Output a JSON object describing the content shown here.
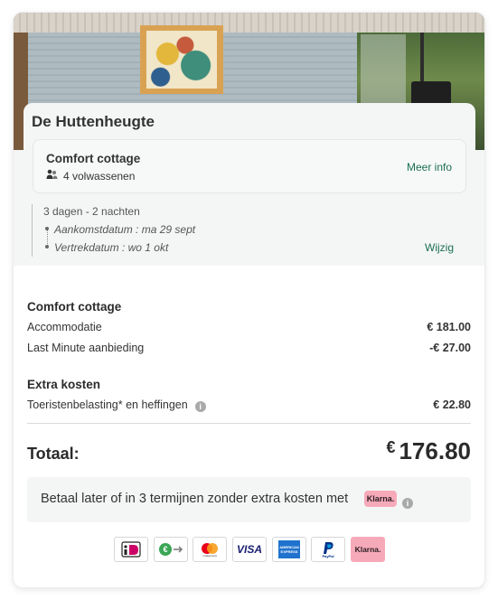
{
  "property": {
    "name": "De Huttenheugte",
    "room_title": "Comfort cottage",
    "guests": "4 volwassenen",
    "more_info": "Meer info"
  },
  "stay": {
    "length": "3 dagen - 2 nachten",
    "arrival": "Aankomstdatum : ma 29 sept",
    "departure": "Vertrekdatum : wo 1 okt",
    "change": "Wijzig"
  },
  "pricing": {
    "section1_title": "Comfort cottage",
    "accommodation_label": "Accommodatie",
    "accommodation_value": "€ 181.00",
    "discount_label": "Last Minute aanbieding",
    "discount_value": "-€ 27.00",
    "section2_title": "Extra kosten",
    "tax_label": "Toeristenbelasting* en heffingen",
    "tax_value": "€ 22.80",
    "total_label": "Totaal:",
    "total_currency": "€",
    "total_value": "176.80"
  },
  "klarna": {
    "text": "Betaal later of in 3 termijnen zonder extra kosten met",
    "badge": "Klarna."
  },
  "payment_methods": [
    {
      "name": "iDEAL",
      "label": "iDEAL"
    },
    {
      "name": "bank-transfer",
      "label": "€→"
    },
    {
      "name": "mastercard",
      "label": "mastercard"
    },
    {
      "name": "visa",
      "label": "VISA"
    },
    {
      "name": "amex",
      "label": "AMERICAN EXPRESS"
    },
    {
      "name": "paypal",
      "label": "PayPal"
    },
    {
      "name": "klarna",
      "label": "Klarna."
    }
  ],
  "colors": {
    "link": "#1c6e53",
    "panel": "#f4f6f6",
    "klarna_pink": "#f6aab9"
  }
}
